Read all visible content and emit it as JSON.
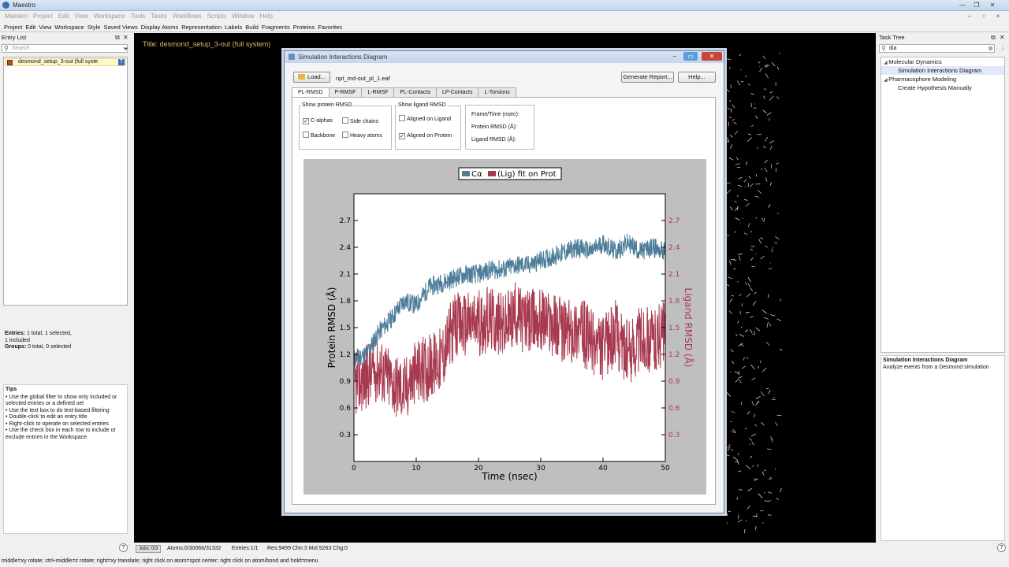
{
  "app": {
    "title": "Maestro"
  },
  "menu_primary": [
    "Maestro",
    "Project",
    "Edit",
    "View",
    "Workspace",
    "Tools",
    "Tasks",
    "Workflows",
    "Scripts",
    "Window",
    "Help"
  ],
  "menu_secondary": [
    "Project",
    "Edit",
    "View",
    "Workspace",
    "Style",
    "Saved Views",
    "Display Atoms",
    "Representation",
    "Labels",
    "Build",
    "Fragments",
    "Proteins",
    "Favorites"
  ],
  "entry_list": {
    "header": "Entry List",
    "search_placeholder": "Search",
    "entry_name": "desmond_setup_3-out (full syste",
    "stats_entries_label": "Entries:",
    "stats_entries": "1 total, 1 selected,",
    "stats_entries2": "1 included",
    "stats_groups_label": "Groups:",
    "stats_groups": "0 total, 0 selected"
  },
  "tips": {
    "title": "Tips",
    "lines": [
      "• Use the global filter to show only included or",
      "selected entries or a defined set",
      "• Use the text box to do text-based filtering",
      "• Double-click to edit an entry title",
      "• Right-click to operate on selected entries",
      "• Use the check box in each row to include or",
      "exclude entries in the Workspace"
    ]
  },
  "workspace": {
    "title": "Title: desmond_setup_3-out (full system)"
  },
  "task_tree": {
    "header": "Task Tree",
    "search_value": "dia",
    "items": [
      {
        "label": "Molecular Dynamics",
        "level": 0,
        "expanded": true
      },
      {
        "label": "Simulation Interactions Diagram",
        "level": 1,
        "selected": true
      },
      {
        "label": "Pharmacophore Modeling",
        "level": 0,
        "expanded": true
      },
      {
        "label": "Create Hypothesis Manually",
        "level": 1
      }
    ],
    "desc_title": "Simulation Interactions Diagram",
    "desc_text": "Analyze events from a Desmond simulation"
  },
  "status": {
    "jobs": "Jobs: 0/3",
    "atoms": "Atoms:0/30066/31332",
    "entries": "Entries:1/1",
    "res": "Res:9499 Chn:3 Mol:9263 Chg:0",
    "hint": "middle=xy rotate; ctrl+middle=z rotate; right=xy translate; right click on atom=spot center; right click on atom/bond and hold=menu",
    "help": "?"
  },
  "dialog": {
    "title": "Simulation Interactions Diagram",
    "load_label": "Load...",
    "file_name": "npt_md-out_pl_1.eaf",
    "generate_label": "Generate Report...",
    "help_label": "Help...",
    "tabs": [
      "PL-RMSD",
      "P-RMSF",
      "L-RMSF",
      "PL-Contacts",
      "LP-Contacts",
      "L-Torsions"
    ],
    "active_tab": "PL-RMSD",
    "protein_group": {
      "legend": "Show protein RMSD",
      "options": [
        {
          "label": "C-alphas",
          "checked": true
        },
        {
          "label": "Side chains",
          "checked": false
        },
        {
          "label": "Backbone",
          "checked": false
        },
        {
          "label": "Heavy atoms",
          "checked": false
        }
      ]
    },
    "ligand_group": {
      "legend": "Show ligand RMSD",
      "options": [
        {
          "label": "Aligned on Ligand",
          "checked": false
        },
        {
          "label": "Aligned on Protein",
          "checked": true
        }
      ]
    },
    "readout": [
      "Frame/Time (nsec):",
      "Protein RMSD (Å):",
      "Ligand RMSD (Å):"
    ]
  },
  "chart_data": {
    "type": "line",
    "xlabel": "Time (nsec)",
    "ylabel": "Protein RMSD (Å)",
    "y2label": "Ligand RMSD (Å)",
    "xlim": [
      0,
      50
    ],
    "ylim": [
      0,
      3.0
    ],
    "y2lim": [
      0,
      3.0
    ],
    "x_ticks": [
      0,
      10,
      20,
      30,
      40,
      50
    ],
    "y_ticks": [
      0.3,
      0.6,
      0.9,
      1.2,
      1.5,
      1.8,
      2.1,
      2.4,
      2.7
    ],
    "y2_ticks": [
      0.3,
      0.6,
      0.9,
      1.2,
      1.5,
      1.8,
      2.1,
      2.4,
      2.7
    ],
    "legend": [
      "Cα",
      "(Lig) fit on Prot"
    ],
    "legend_position": "top-center",
    "series": [
      {
        "name": "Cα",
        "axis": "left",
        "color": "#4d7d99",
        "x": [
          0,
          2,
          4,
          6,
          8,
          10,
          12,
          14,
          16,
          18,
          20,
          22,
          24,
          26,
          28,
          30,
          32,
          34,
          36,
          38,
          40,
          42,
          44,
          46,
          48,
          50
        ],
        "y": [
          1.15,
          1.2,
          1.45,
          1.6,
          1.8,
          1.75,
          1.95,
          2.0,
          2.05,
          2.1,
          2.1,
          2.15,
          2.15,
          2.2,
          2.2,
          2.25,
          2.3,
          2.35,
          2.4,
          2.35,
          2.45,
          2.35,
          2.45,
          2.35,
          2.4,
          2.35
        ]
      },
      {
        "name": "(Lig) fit on Prot",
        "axis": "right",
        "color": "#a83a50",
        "x": [
          0,
          2,
          4,
          6,
          8,
          10,
          12,
          14,
          16,
          18,
          20,
          22,
          24,
          26,
          28,
          30,
          32,
          34,
          36,
          38,
          40,
          42,
          44,
          46,
          48,
          50
        ],
        "y": [
          0.85,
          0.95,
          1.05,
          0.9,
          0.8,
          1.0,
          1.05,
          1.15,
          1.5,
          1.55,
          1.55,
          1.6,
          1.5,
          1.65,
          1.55,
          1.6,
          1.55,
          1.45,
          1.5,
          1.35,
          1.25,
          1.45,
          1.2,
          1.4,
          1.35,
          1.45
        ]
      }
    ],
    "colors": {
      "plot_bg": "#bfbfbf",
      "axes_bg": "#ffffff"
    }
  }
}
